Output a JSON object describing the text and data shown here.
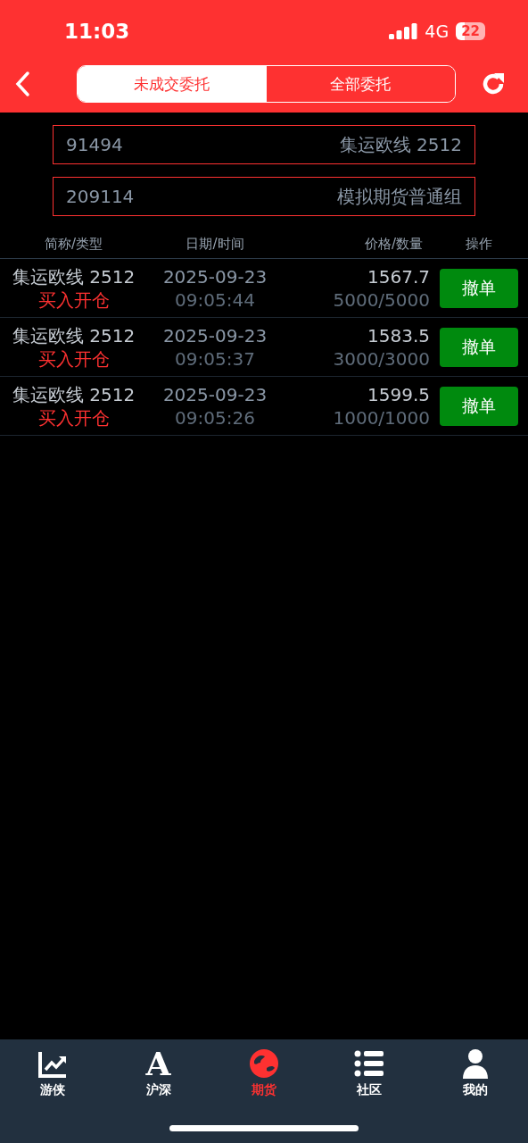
{
  "status_bar": {
    "time": "11:03",
    "network": "4G",
    "battery": "22"
  },
  "segments": [
    {
      "label": "未成交委托",
      "selected": true
    },
    {
      "label": "全部委托",
      "selected": false
    }
  ],
  "account_fields": [
    {
      "value": "91494",
      "label": "集运欧线 2512"
    },
    {
      "value": "209114",
      "label": "模拟期货普通组"
    }
  ],
  "table": {
    "columns": [
      "简称/类型",
      "日期/时间",
      "价格/数量",
      "操作"
    ],
    "rows": [
      {
        "name": "集运欧线 2512",
        "type": "买入开仓",
        "date": "2025-09-23",
        "time": "09:05:44",
        "price": "1567.7",
        "quantity": "5000/5000",
        "action": "撤单"
      },
      {
        "name": "集运欧线 2512",
        "type": "买入开仓",
        "date": "2025-09-23",
        "time": "09:05:37",
        "price": "1583.5",
        "quantity": "3000/3000",
        "action": "撤单"
      },
      {
        "name": "集运欧线 2512",
        "type": "买入开仓",
        "date": "2025-09-23",
        "time": "09:05:26",
        "price": "1599.5",
        "quantity": "1000/1000",
        "action": "撤单"
      }
    ]
  },
  "tab_bar": [
    {
      "kind": "chart",
      "label": "游侠",
      "selected": false
    },
    {
      "kind": "letter",
      "glyph": "A",
      "label": "沪深",
      "selected": false
    },
    {
      "kind": "globe",
      "label": "期货",
      "selected": true
    },
    {
      "kind": "list",
      "label": "社区",
      "selected": false
    },
    {
      "kind": "person",
      "label": "我的",
      "selected": false
    }
  ]
}
